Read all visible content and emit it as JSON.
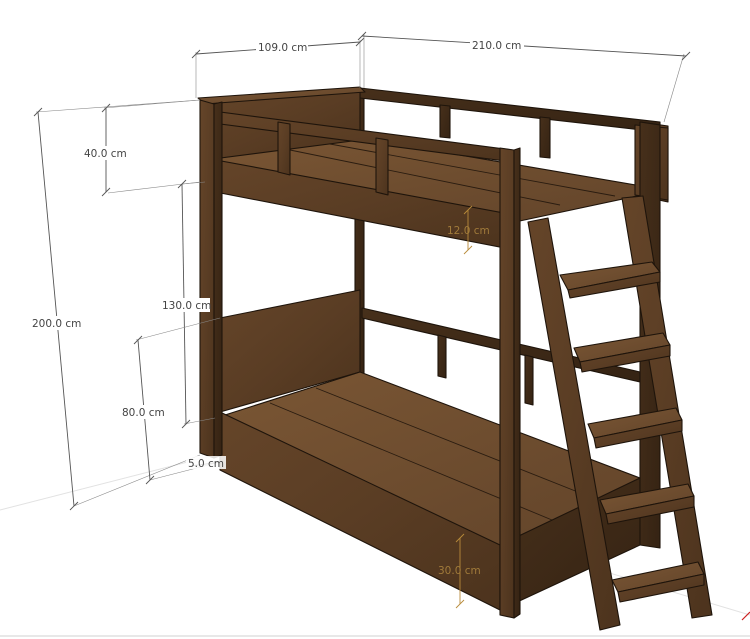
{
  "dimensions": {
    "width_label": "109.0 cm",
    "length_label": "210.0 cm",
    "total_height_label": "200.0 cm",
    "guard_height_label": "40.0 cm",
    "upper_clearance_label": "130.0 cm",
    "lower_headboard_label": "80.0 cm",
    "leg_gap_label": "5.0 cm",
    "frame_thickness_label": "12.0 cm",
    "lower_side_label": "30.0 cm"
  },
  "colors": {
    "wood": "#5a3d24",
    "wood_dark": "#3d2916",
    "wood_light": "#6b4a2c",
    "dimension_line": "#555555",
    "dimension_accent": "#b88a3a",
    "background": "#ffffff",
    "floor_grid": "#dedede",
    "corner_axis": "#cc2222"
  }
}
